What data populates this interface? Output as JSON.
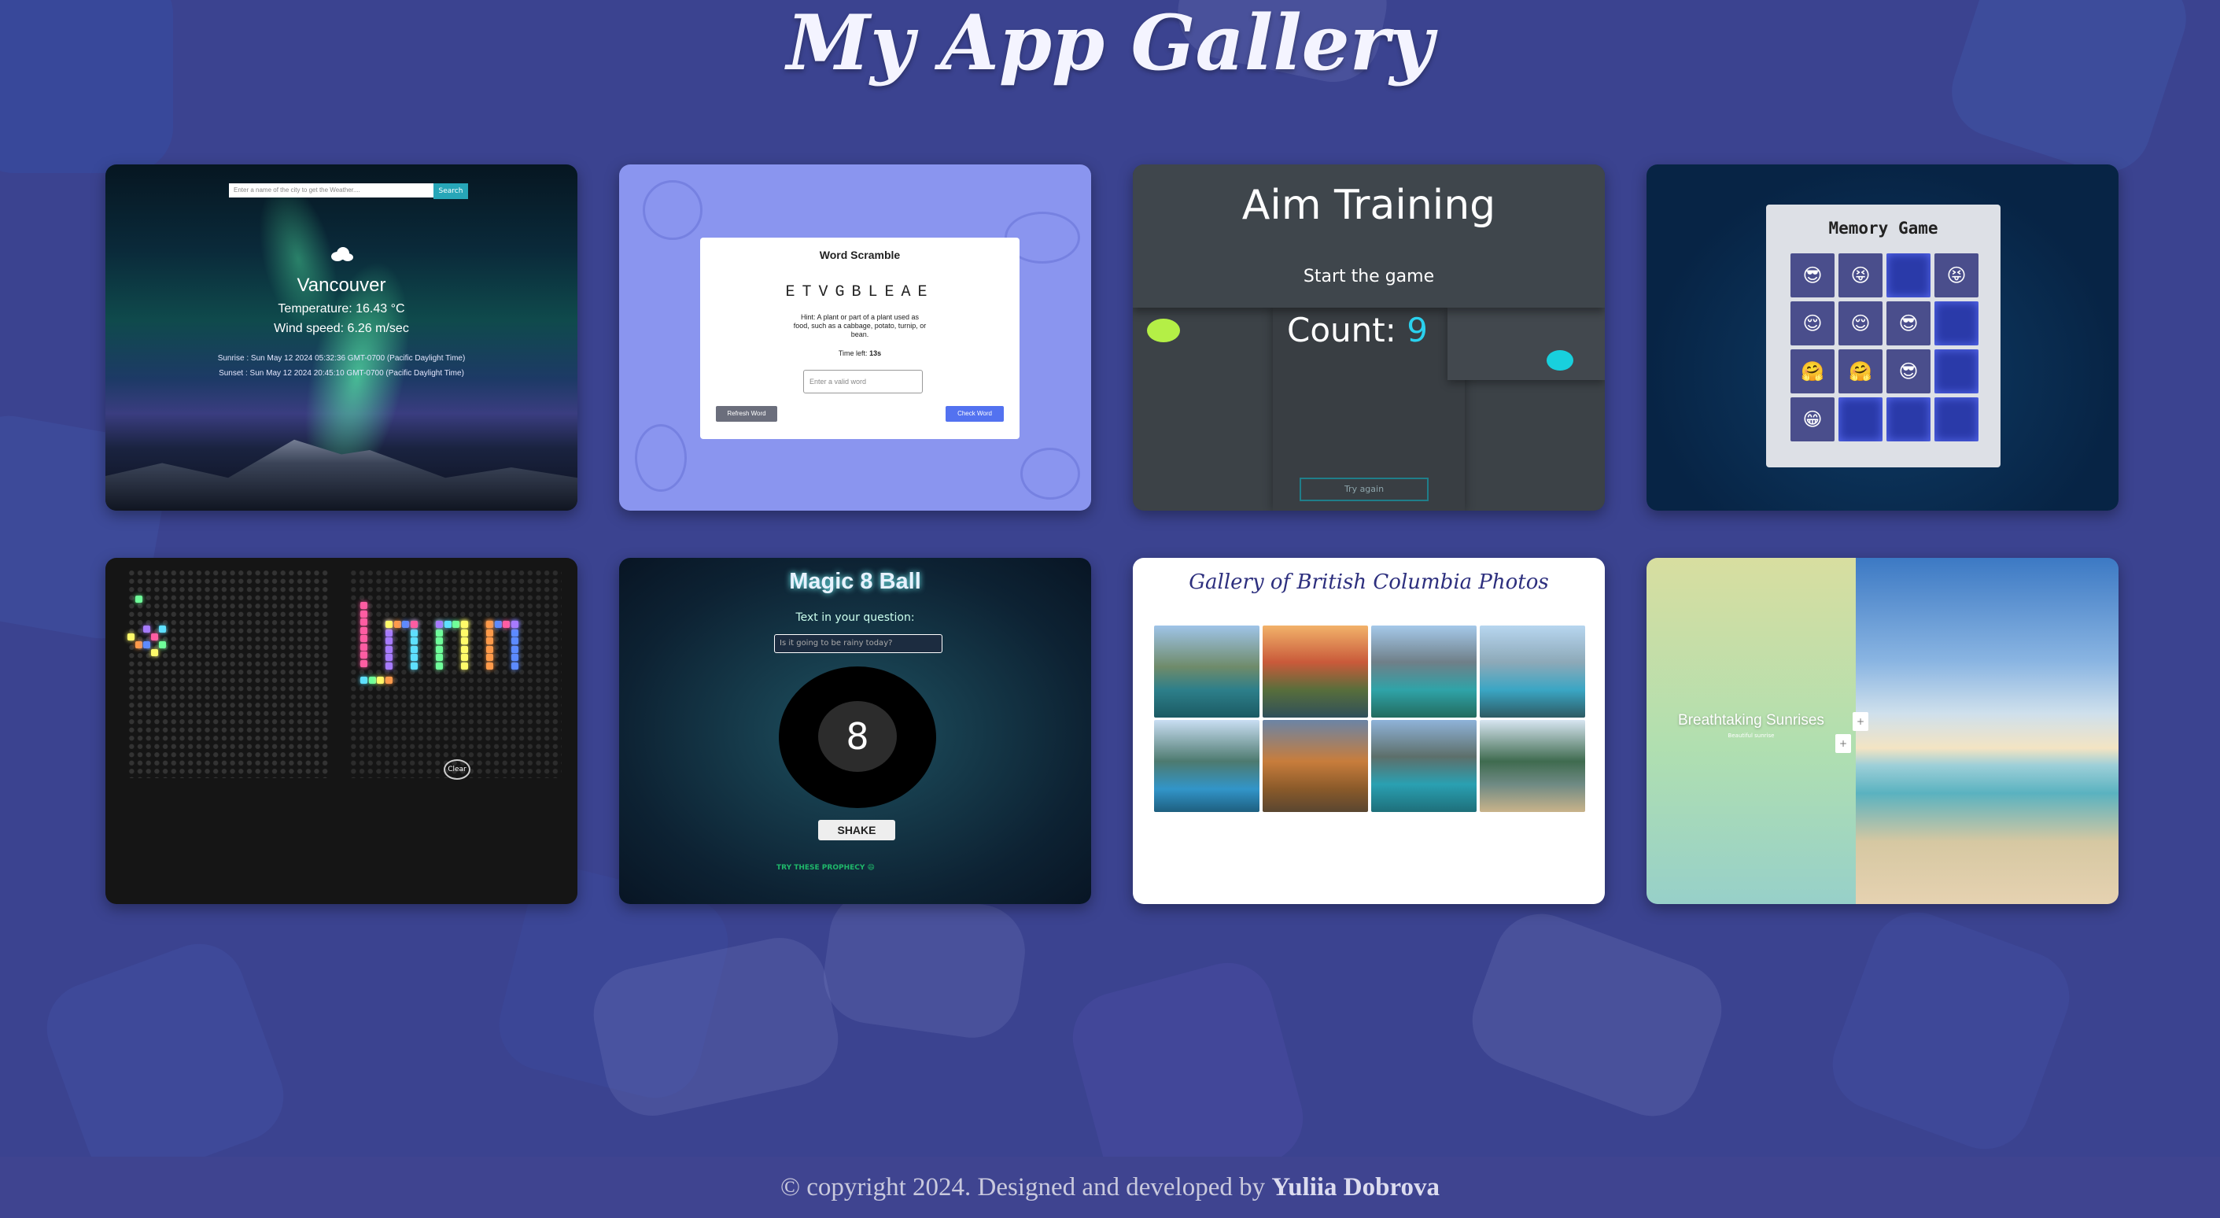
{
  "page": {
    "title": "My App Gallery"
  },
  "footer": {
    "prefix": "© copyright 2024. Designed and developed by",
    "author": "Yuliia Dobrova"
  },
  "weather": {
    "search_placeholder": "Enter a name of the city to get the Weather....",
    "search_button": "Search",
    "city": "Vancouver",
    "temperature": "Temperature: 16.43 °C",
    "wind": "Wind speed: 6.26 m/sec",
    "sunrise": "Sunrise : Sun May 12 2024 05:32:36 GMT-0700 (Pacific Daylight Time)",
    "sunset": "Sunset : Sun May 12 2024 20:45:10 GMT-0700 (Pacific Daylight Time)"
  },
  "scramble": {
    "title": "Word Scramble",
    "letters": "ETVGBLEAE",
    "hint": "Hint: A plant or part of a plant used as food, such as a cabbage, potato, turnip, or bean.",
    "time_label": "Time left:",
    "time_value": "13s",
    "input_placeholder": "Enter a valid word",
    "refresh": "Refresh Word",
    "check": "Check Word"
  },
  "aim": {
    "title": "Aim Training",
    "start": "Start the game",
    "count_label": "Count:",
    "count_value": "9",
    "button": "Try again"
  },
  "memory": {
    "title": "Memory Game",
    "cells": [
      "😎",
      "😝",
      "",
      "😝",
      "😌",
      "😌",
      "😎",
      "",
      "🤗",
      "🤗",
      "😎",
      "",
      "😁",
      "",
      "",
      ""
    ]
  },
  "light": {
    "clear": "Clear"
  },
  "magic": {
    "title": "Magic 8 Ball",
    "label": "Text in your question:",
    "input_placeholder": "Is it going to be rainy today?",
    "ball": "8",
    "shake": "SHAKE",
    "footer": "TRY THESE PROPHECY 😄"
  },
  "bc": {
    "title": "Gallery of British Columbia Photos"
  },
  "sunrise": {
    "text": "Breathtaking Sunrises",
    "sub": "Beautiful sunrise",
    "prev": "+",
    "next": "+"
  },
  "colors": {
    "background": "#3b4390",
    "accent_cyan": "#2ad1ee",
    "footer_text": "#c9c9dd"
  }
}
